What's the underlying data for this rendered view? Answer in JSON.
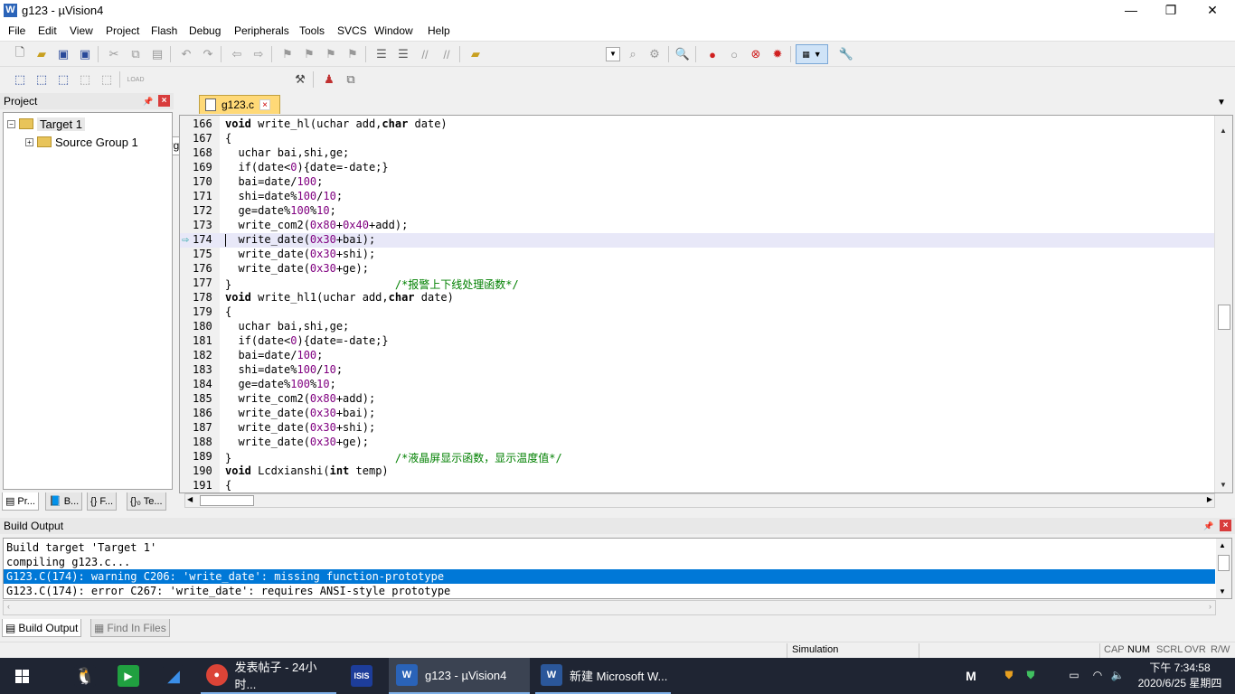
{
  "window": {
    "title": "g123  - µVision4",
    "min": "—",
    "max": "❐",
    "close": "✕"
  },
  "menu": [
    "File",
    "Edit",
    "View",
    "Project",
    "Flash",
    "Debug",
    "Peripherals",
    "Tools",
    "SVCS",
    "Window",
    "Help"
  ],
  "toolbar2": {
    "target": "Target 1"
  },
  "project_panel": {
    "title": "Project",
    "tree": [
      {
        "label": "Target 1"
      },
      {
        "label": "Source Group 1"
      }
    ],
    "tabs": [
      "Pr...",
      "B...",
      "{} F...",
      "{}₀ Te..."
    ]
  },
  "editor": {
    "file_tab": "g123.c",
    "lines": [
      {
        "n": "166",
        "t": "void write_hl(uchar add,char date)"
      },
      {
        "n": "167",
        "t": "{"
      },
      {
        "n": "168",
        "t": "  uchar bai,shi,ge;"
      },
      {
        "n": "169",
        "t": "  if(date<0){date=-date;}"
      },
      {
        "n": "170",
        "t": "  bai=date/100;"
      },
      {
        "n": "171",
        "t": "  shi=date%100/10;"
      },
      {
        "n": "172",
        "t": "  ge=date%100%10;"
      },
      {
        "n": "173",
        "t": "  write_com2(0x80+0x40+add);"
      },
      {
        "n": "174",
        "t": "  write_date(0x30+bai);"
      },
      {
        "n": "175",
        "t": "  write_date(0x30+shi);"
      },
      {
        "n": "176",
        "t": "  write_date(0x30+ge);"
      },
      {
        "n": "177",
        "t": "}                         /*报警上下线处理函数*/"
      },
      {
        "n": "178",
        "t": "void write_hl1(uchar add,char date)"
      },
      {
        "n": "179",
        "t": "{"
      },
      {
        "n": "180",
        "t": "  uchar bai,shi,ge;"
      },
      {
        "n": "181",
        "t": "  if(date<0){date=-date;}"
      },
      {
        "n": "182",
        "t": "  bai=date/100;"
      },
      {
        "n": "183",
        "t": "  shi=date%100/10;"
      },
      {
        "n": "184",
        "t": "  ge=date%100%10;"
      },
      {
        "n": "185",
        "t": "  write_com2(0x80+add);"
      },
      {
        "n": "186",
        "t": "  write_date(0x30+bai);"
      },
      {
        "n": "187",
        "t": "  write_date(0x30+shi);"
      },
      {
        "n": "188",
        "t": "  write_date(0x30+ge);"
      },
      {
        "n": "189",
        "t": "}                         /*液晶屏显示函数，显示温度值*/"
      },
      {
        "n": "190",
        "t": "void Lcdxianshi(int temp)"
      },
      {
        "n": "191",
        "t": "{"
      }
    ]
  },
  "build_output": {
    "title": "Build Output",
    "lines": [
      "Build target 'Target 1'",
      "compiling g123.c...",
      "G123.C(174): warning C206: 'write_date': missing function-prototype",
      "G123.C(174): error C267: 'write_date': requires ANSI-style prototype"
    ],
    "tabs": [
      "Build Output",
      "Find In Files"
    ]
  },
  "status": {
    "mode": "Simulation",
    "cap": "CAP",
    "num": "NUM",
    "scrl": "SCRL",
    "ovr": "OVR",
    "rw": "R/W"
  },
  "taskbar": {
    "apps": [
      {
        "label": "发表帖子 - 24小时..."
      },
      {
        "label": "g123  - µVision4"
      },
      {
        "label": "新建 Microsoft W..."
      }
    ],
    "time": "下午 7:34:58",
    "date": "2020/6/25 星期四"
  }
}
